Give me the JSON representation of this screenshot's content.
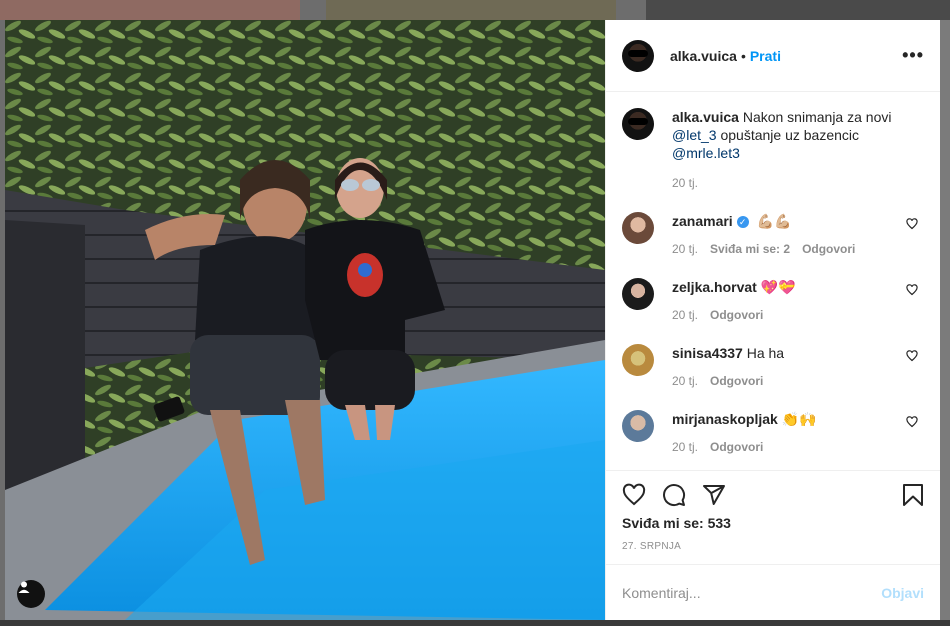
{
  "post": {
    "username": "alka.vuica",
    "separator": "•",
    "follow_label": "Prati",
    "more_label": "•••"
  },
  "caption": {
    "username": "alka.vuica",
    "text_before": " Nakon snimanja za novi ",
    "mention1": "@let_3",
    "text_middle": " opuštanje uz bazencic ",
    "mention2": "@mrle.let3",
    "time": "20 tj."
  },
  "comments": [
    {
      "username": "zanamari",
      "verified": true,
      "text": "💪🏼💪🏼",
      "time": "20 tj.",
      "likes": "Sviđa mi se: 2",
      "reply": "Odgovori"
    },
    {
      "username": "zeljka.horvat",
      "verified": false,
      "text": "💖💝",
      "time": "20 tj.",
      "likes": "",
      "reply": "Odgovori"
    },
    {
      "username": "sinisa4337",
      "verified": false,
      "text": "Ha ha",
      "time": "20 tj.",
      "likes": "",
      "reply": "Odgovori"
    },
    {
      "username": "mirjanaskopljak",
      "verified": false,
      "text": "👏🙌",
      "time": "20 tj.",
      "likes": "",
      "reply": "Odgovori"
    }
  ],
  "actions": {
    "likes_text": "Sviđa mi se: 533",
    "date": "27. SRPNJA"
  },
  "comment_box": {
    "placeholder": "Komentiraj...",
    "post_label": "Objavi"
  },
  "colors": {
    "link_blue": "#0095f6",
    "disabled_blue": "#b2dffc",
    "mention": "#00376b",
    "pool": "#1aa8f0"
  },
  "icons": [
    "heart-icon",
    "comment-icon",
    "share-icon",
    "bookmark-icon",
    "more-icon",
    "user-tag-icon"
  ]
}
